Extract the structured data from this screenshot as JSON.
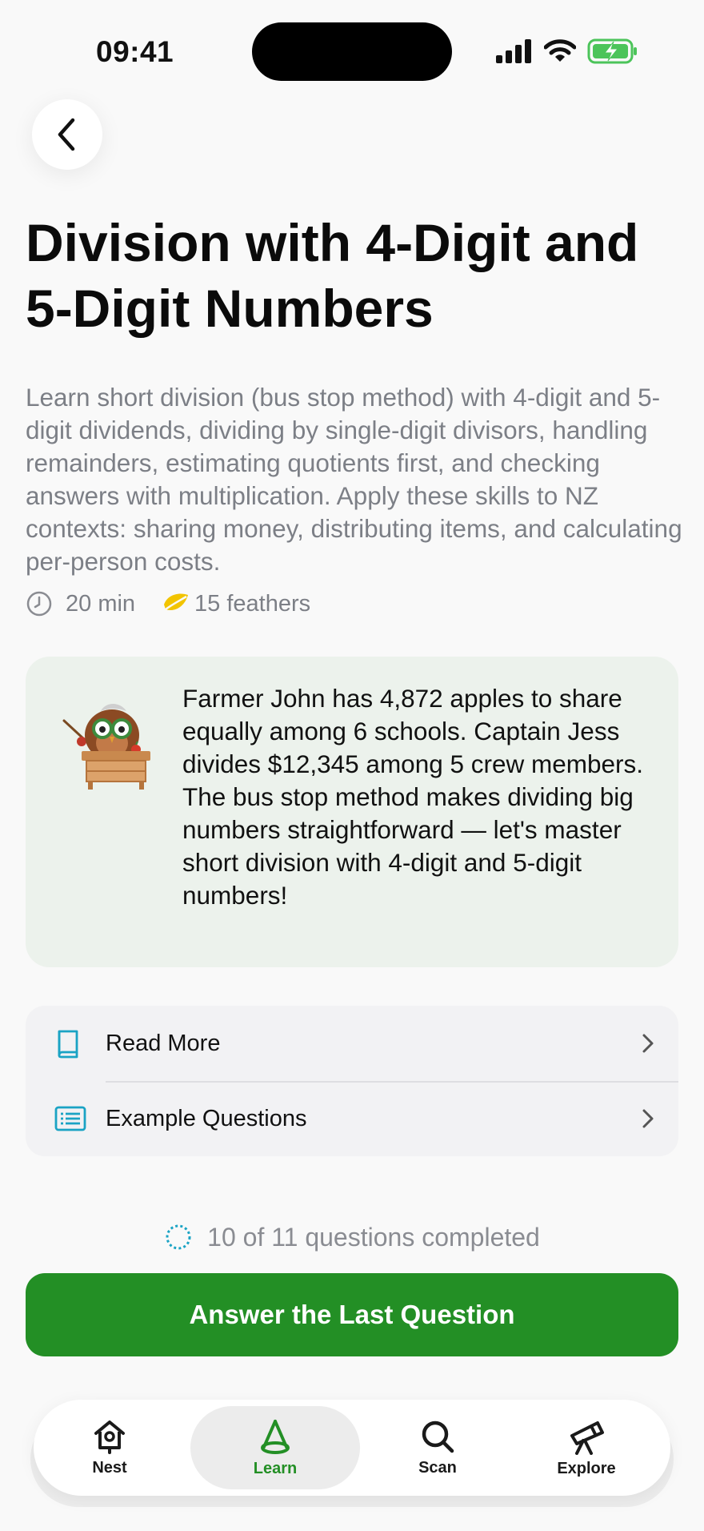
{
  "status_bar": {
    "time": "09:41"
  },
  "header": {
    "back_icon": "chevron-left-icon"
  },
  "lesson": {
    "title": "Division with 4-Digit and 5-Digit Numbers",
    "description": "Learn short division (bus stop method) with 4-digit and 5-digit dividends, dividing by single-digit divisors, handling remainders, estimating quotients first, and checking answers with multiplication. Apply these skills to NZ contexts: sharing money, distributing items, and calculating per-person costs.",
    "duration": "20 min",
    "reward": "15 feathers"
  },
  "story": {
    "text": "Farmer John has 4,872 apples to share equally among 6 schools. Captain Jess divides $12,345 among 5 crew members. The bus stop method makes dividing big numbers straightforward — let's master short division with 4-digit and 5-digit numbers!"
  },
  "links": [
    {
      "label": "Read More",
      "icon": "book-icon"
    },
    {
      "label": "Example Questions",
      "icon": "list-icon"
    }
  ],
  "progress": {
    "text": "10 of 11 questions completed"
  },
  "cta": {
    "label": "Answer the Last Question"
  },
  "tabs": [
    {
      "label": "Nest",
      "icon": "birdhouse-icon"
    },
    {
      "label": "Learn",
      "icon": "cone-icon"
    },
    {
      "label": "Scan",
      "icon": "search-icon"
    },
    {
      "label": "Explore",
      "icon": "telescope-icon"
    }
  ],
  "colors": {
    "accent": "#238f25",
    "card_bg": "#ecf2ec",
    "icon_teal": "#1aa3c4",
    "feather": "#f2c400"
  }
}
